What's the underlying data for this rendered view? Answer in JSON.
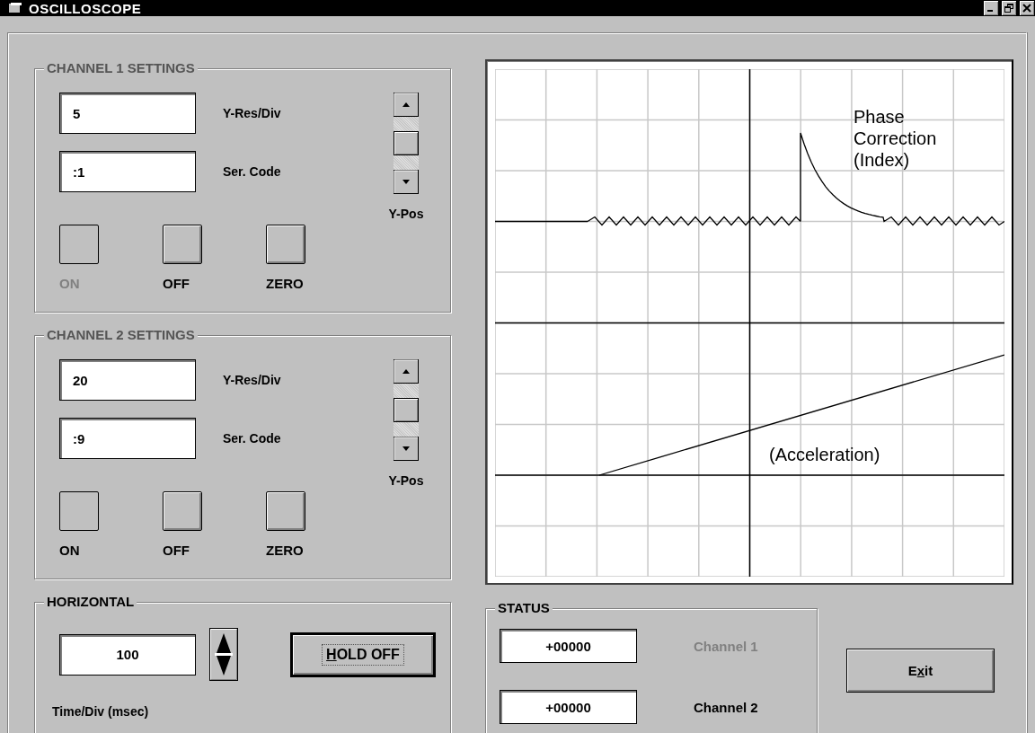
{
  "window": {
    "title": "OSCILLOSCOPE"
  },
  "channels": [
    {
      "title": "CHANNEL 1 SETTINGS",
      "title_dimmed": true,
      "fields": [
        {
          "value": "5",
          "label": "Y-Res/Div"
        },
        {
          "value": ":1",
          "label": "Ser. Code"
        }
      ],
      "scroll_label": "Y-Pos",
      "buttons": [
        {
          "label": "ON",
          "pressed": true,
          "disabled": true
        },
        {
          "label": "OFF",
          "pressed": false,
          "disabled": false
        },
        {
          "label": "ZERO",
          "pressed": false,
          "disabled": false
        }
      ]
    },
    {
      "title": "CHANNEL 2 SETTINGS",
      "title_dimmed": true,
      "fields": [
        {
          "value": "20",
          "label": "Y-Res/Div"
        },
        {
          "value": ":9",
          "label": "Ser. Code"
        }
      ],
      "scroll_label": "Y-Pos",
      "buttons": [
        {
          "label": "ON",
          "pressed": true,
          "disabled": false
        },
        {
          "label": "OFF",
          "pressed": false,
          "disabled": false
        },
        {
          "label": "ZERO",
          "pressed": false,
          "disabled": false
        }
      ]
    }
  ],
  "horizontal": {
    "title": "HORIZONTAL",
    "title_dimmed": false,
    "value": "100",
    "button": {
      "label": "HOLD OFF",
      "default": true
    },
    "caption": "Time/Div (msec)"
  },
  "scope": {
    "traces": [
      {
        "kind": "pulse",
        "label": "Phase Correction (Index)"
      },
      {
        "kind": "ramp",
        "label": "(Acceleration)"
      }
    ]
  },
  "status": {
    "title": "STATUS",
    "title_dimmed": false,
    "readings": [
      {
        "value": "+00000",
        "label": "Channel 1",
        "disabled": true
      },
      {
        "value": "+00000",
        "label": "Channel 2",
        "disabled": false
      }
    ]
  },
  "exit_button": {
    "label": "Exit",
    "default": false
  }
}
